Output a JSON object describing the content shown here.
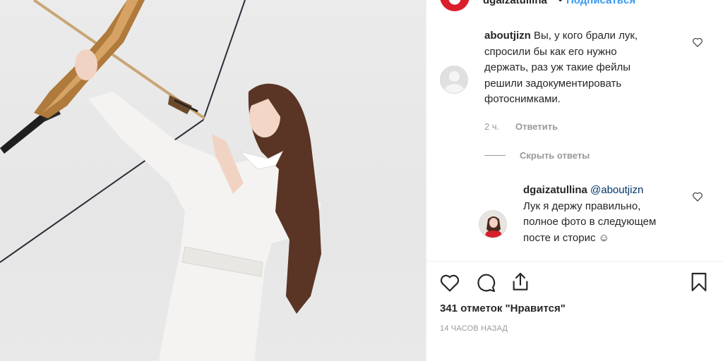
{
  "header": {
    "username": "dgaizatullina",
    "separator": "•",
    "follow_label": "Подписаться"
  },
  "comments": [
    {
      "username": "aboutjizn",
      "lines": [
        "Вы, у кого брали лук,",
        "спросили бы как его нужно",
        "держать, раз уж такие фейлы",
        "решили задокументировать",
        "фотоснимками."
      ],
      "age": "2 ч.",
      "reply_label": "Ответить",
      "toggle_replies_label": "Скрыть ответы"
    },
    {
      "username": "dgaizatullina",
      "mention": "@aboutjizn",
      "lines": [
        "Лук я держу правильно,",
        "полное фото в следующем",
        "посте и сторис ☺"
      ]
    }
  ],
  "actions": {
    "like_icon": "heart-icon",
    "comment_icon": "comment-bubble-icon",
    "share_icon": "share-icon",
    "save_icon": "bookmark-icon"
  },
  "likes_text": "341 отметок \"Нравится\"",
  "timestamp": "14 часов назад",
  "colors": {
    "link_blue": "#3897f0",
    "text": "#262626",
    "muted": "#999999",
    "divider": "#efefef"
  }
}
